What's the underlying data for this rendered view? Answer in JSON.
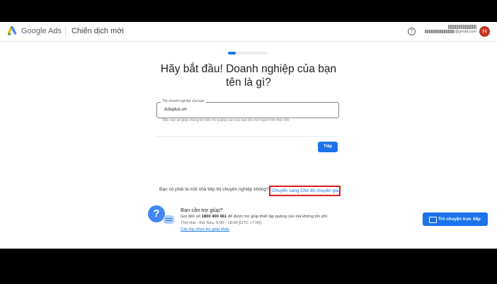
{
  "header": {
    "brand_google": "Google",
    "brand_ads": "Ads",
    "title": "Chiến dịch mới",
    "help_icon": "help-circle-icon",
    "account_email_suffix": "@gmail.com",
    "avatar_initial": "H",
    "avatar_color": "#c5341f"
  },
  "progress": {
    "fraction": 0.2
  },
  "main": {
    "heading": "Hãy bắt đầu! Doanh nghiệp của bạn tên là gì?",
    "business_field": {
      "label": "Tên doanh nghiệp của bạn",
      "value": "Adsplus.vn",
      "hint": "Việc này sẽ giúp chúng tôi hiển thị quảng cáo của bạn khi mọi người tìm theo tên"
    },
    "next_button": "Tiếp"
  },
  "expert": {
    "question": "Bạn có phải là một nhà tiếp thị chuyên nghiệp không?",
    "link": "Chuyển sang Chế độ chuyên gia"
  },
  "help": {
    "title": "Bạn cần trợ giúp?",
    "line1_prefix": "Gọi đến số",
    "phone": "1800 400 461",
    "line1_suffix": "để được trợ giúp thiết lập quảng cáo mà không tốn phí",
    "hours": "Thứ Hai - thứ Sáu, 9:00 - 18:00 [UTC +7:00]",
    "other_options": "Các tùy chọn trợ giúp khác"
  },
  "chat_button": "Trò chuyện trực tiếp",
  "colors": {
    "accent": "#1a73e8",
    "highlight_box": "#e01b1b"
  }
}
